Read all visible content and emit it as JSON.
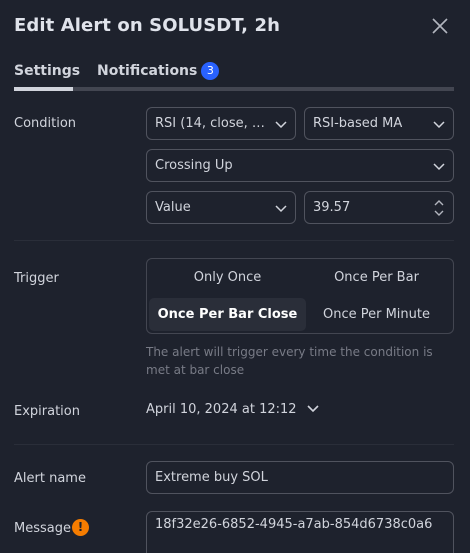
{
  "header": {
    "title": "Edit Alert on SOLUSDT, 2h",
    "close_icon": "close-icon"
  },
  "tabs": [
    {
      "label": "Settings",
      "active": true
    },
    {
      "label": "Notifications",
      "badge": "3"
    }
  ],
  "condition": {
    "label": "Condition",
    "indicator": "RSI (14, close, S...",
    "target": "RSI-based MA",
    "operator": "Crossing Up",
    "value_type": "Value",
    "value": "39.57"
  },
  "trigger": {
    "label": "Trigger",
    "options": [
      "Only Once",
      "Once Per Bar",
      "Once Per Bar Close",
      "Once Per Minute"
    ],
    "selected": "Once Per Bar Close",
    "hint": "The alert will trigger every time the condition is met at bar close"
  },
  "expiration": {
    "label": "Expiration",
    "value": "April 10, 2024 at 12:12"
  },
  "alert_name": {
    "label": "Alert name",
    "value": "Extreme buy SOL"
  },
  "message": {
    "label": "Message",
    "warning": "!",
    "value": "18f32e26-6852-4945-a7ab-854d6738c0a6"
  },
  "colors": {
    "background": "#1e222d",
    "accent": "#2962ff",
    "warning": "#f57c00",
    "border": "#50535e"
  }
}
